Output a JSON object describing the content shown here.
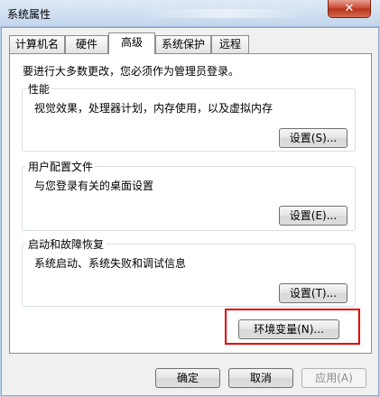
{
  "window": {
    "title": "系统属性",
    "close_label": "✕"
  },
  "tabs": [
    {
      "label": "计算机名"
    },
    {
      "label": "硬件"
    },
    {
      "label": "高级"
    },
    {
      "label": "系统保护"
    },
    {
      "label": "远程"
    }
  ],
  "advanced": {
    "admin_note": "要进行大多数更改，您必须作为管理员登录。",
    "performance": {
      "title": "性能",
      "description": "视觉效果，处理器计划，内存使用，以及虚拟内存",
      "button": "设置(S)..."
    },
    "user_profiles": {
      "title": "用户配置文件",
      "description": "与您登录有关的桌面设置",
      "button": "设置(E)..."
    },
    "startup_recovery": {
      "title": "启动和故障恢复",
      "description": "系统启动、系统失败和调试信息",
      "button": "设置(T)..."
    },
    "env_button": "环境变量(N)..."
  },
  "footer": {
    "ok": "确定",
    "cancel": "取消",
    "apply": "应用(A)"
  },
  "colors": {
    "highlight": "#e20000",
    "titlebar": "#c4d6ec",
    "close": "#c7442d"
  }
}
